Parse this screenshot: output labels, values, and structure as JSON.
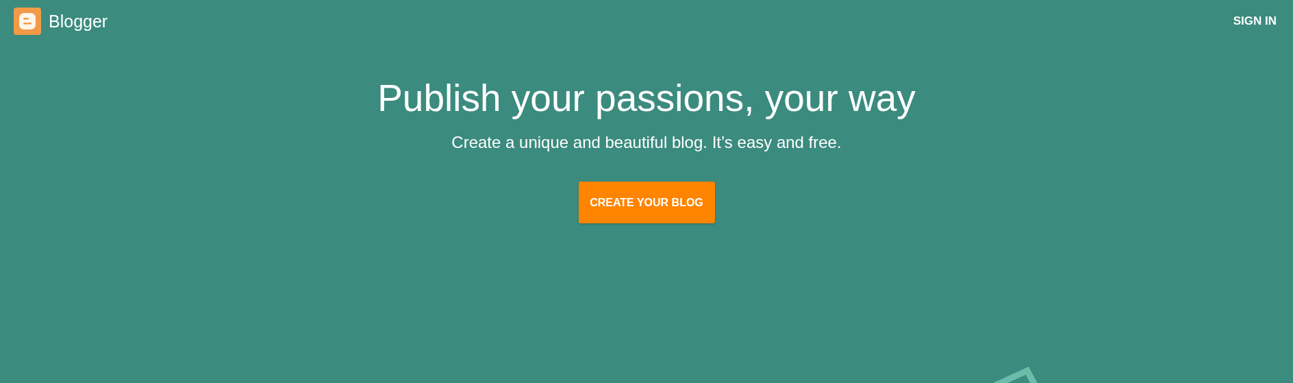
{
  "header": {
    "brand": "Blogger",
    "sign_in": "SIGN IN"
  },
  "hero": {
    "title": "Publish your passions, your way",
    "subtitle": "Create a unique and beautiful blog. It’s easy and free.",
    "button": "CREATE YOUR BLOG"
  }
}
